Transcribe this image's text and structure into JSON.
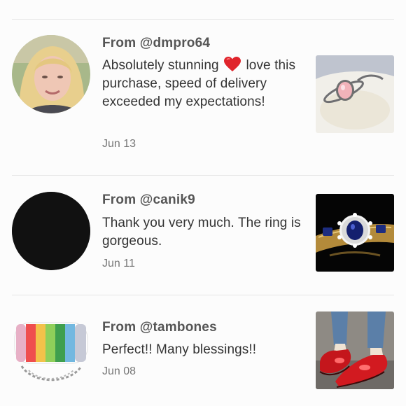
{
  "reviews": [
    {
      "from": "From @dmpro64",
      "message_before_heart": "Absolutely stunning",
      "message_after_heart": "love this purchase, speed of delivery exceeded my expectations!",
      "date": "Jun 13",
      "avatar_icon": "user-photo-blonde-woman",
      "thumb_icon": "pink-opal-ring-photo"
    },
    {
      "from": "From @canik9",
      "message": "Thank you very much. The ring is gorgeous.",
      "date": "Jun 11",
      "avatar_icon": "black-circle-avatar",
      "thumb_icon": "sapphire-diamond-ring-photo"
    },
    {
      "from": "From @tambones",
      "message": "Perfect!! Many blessings!!",
      "date": "Jun 08",
      "avatar_icon": "rainbow-clutch-bag-photo",
      "thumb_icon": "red-shoes-photo"
    }
  ],
  "colors": {
    "divider": "#e6e6e6",
    "heart": "#e0242b",
    "avatar_black": "#111111"
  }
}
